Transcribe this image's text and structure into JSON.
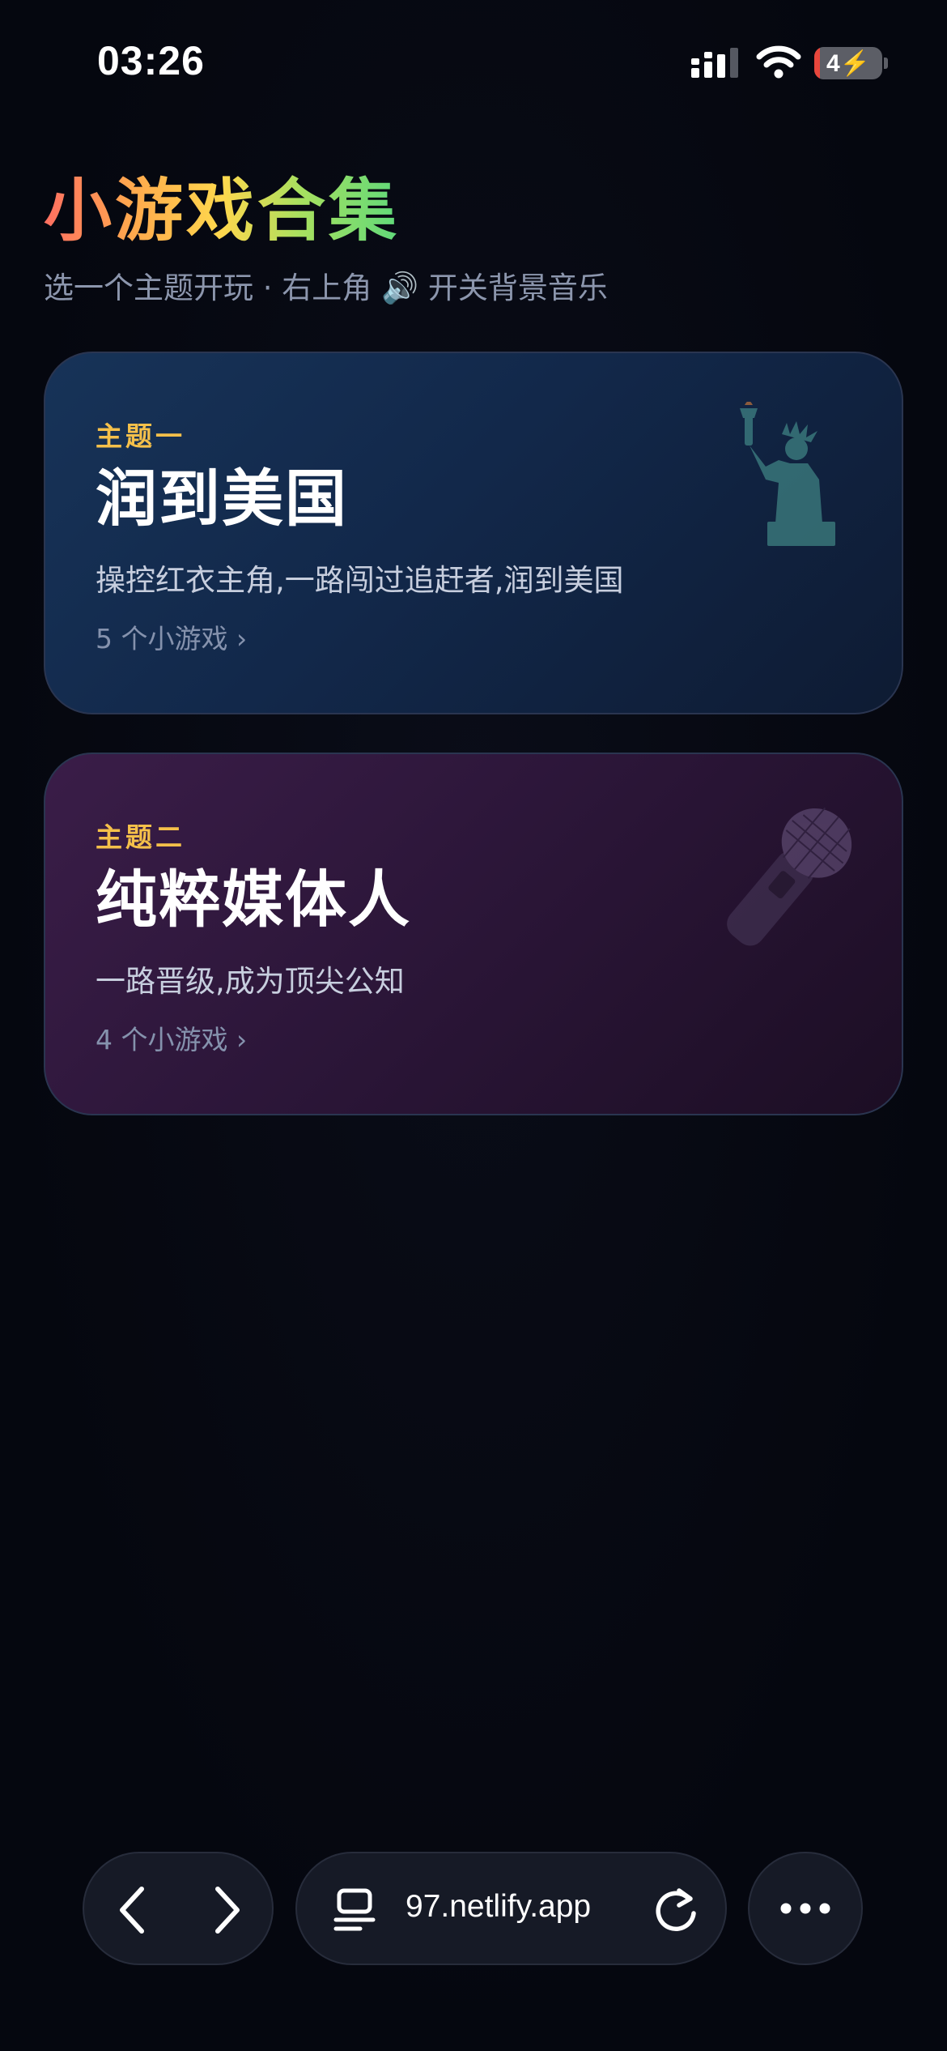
{
  "status_bar": {
    "time": "03:26",
    "battery_label": "4",
    "battery_level": 0.04,
    "icons": [
      "cellular-signal-icon",
      "wifi-icon",
      "battery-charging-icon"
    ]
  },
  "header": {
    "title": "小游戏合集",
    "subtitle": "选一个主题开玩 · 右上角 🔊 开关背景音乐"
  },
  "themes": [
    {
      "eyebrow": "主题一",
      "title": "润到美国",
      "description": "操控红衣主角,一路闯过追赶者,润到美国",
      "count": "5 个小游戏 ›",
      "art": "statue-of-liberty-icon"
    },
    {
      "eyebrow": "主题二",
      "title": "纯粹媒体人",
      "description": "一路晋级,成为顶尖公知",
      "count": "4 个小游戏 ›",
      "art": "microphone-icon"
    }
  ],
  "browser": {
    "url": "97.netlify.app",
    "icons": [
      "back-icon",
      "forward-icon",
      "tabs-icon",
      "reload-icon",
      "more-icon"
    ]
  },
  "colors": {
    "background": "#05070f",
    "accent_eyebrow": "#f5c04a",
    "card1": "#173358",
    "card2": "#3a1d48"
  }
}
